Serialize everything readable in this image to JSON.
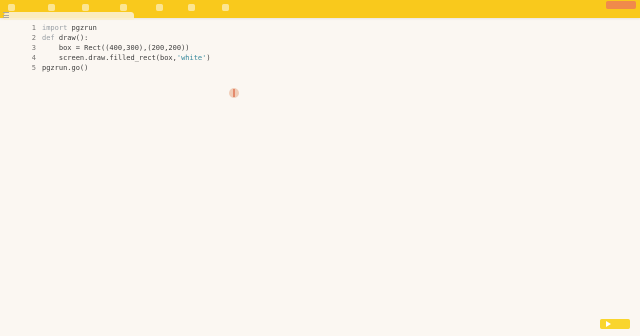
{
  "editor": {
    "lines": [
      {
        "num": "1",
        "parts": [
          {
            "t": "import",
            "c": "kw"
          },
          {
            "t": " pgzrun",
            "c": ""
          }
        ]
      },
      {
        "num": "2",
        "parts": [
          {
            "t": "def",
            "c": "kw"
          },
          {
            "t": " draw():",
            "c": ""
          }
        ]
      },
      {
        "num": "3",
        "parts": [
          {
            "t": "    box = Rect((400,300),(200,200))",
            "c": ""
          }
        ]
      },
      {
        "num": "4",
        "parts": [
          {
            "t": "    screen.draw.filled_rect(box,",
            "c": ""
          },
          {
            "t": "'white'",
            "c": "str"
          },
          {
            "t": ")",
            "c": ""
          }
        ]
      },
      {
        "num": "5",
        "parts": [
          {
            "t": "pgzrun.go()",
            "c": ""
          }
        ]
      }
    ]
  },
  "colors": {
    "topbar": "#f9c91c",
    "background": "#fbf7f2",
    "run_button": "#f9d52e"
  }
}
